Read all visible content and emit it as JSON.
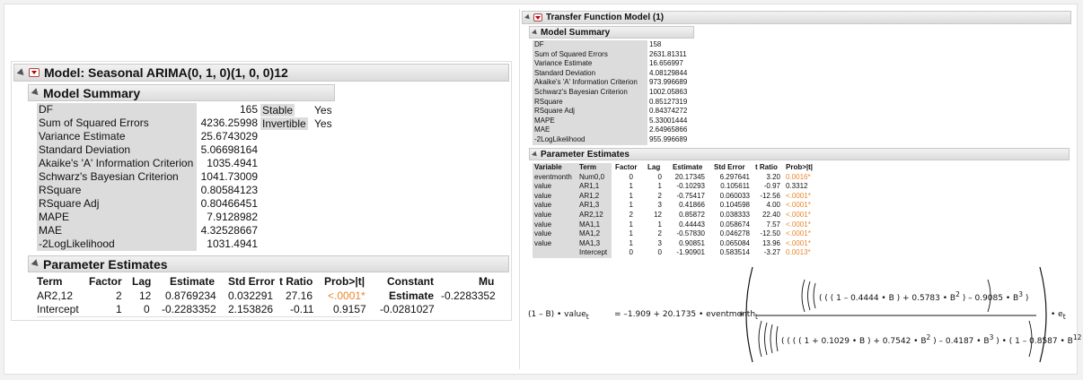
{
  "left": {
    "title": "Model: Seasonal ARIMA(0, 1, 0)(1, 0, 0)12",
    "summary_title": "Model Summary",
    "summary": [
      {
        "label": "DF",
        "value": "165"
      },
      {
        "label": "Sum of Squared Errors",
        "value": "4236.25998"
      },
      {
        "label": "Variance Estimate",
        "value": "25.6743029"
      },
      {
        "label": "Standard Deviation",
        "value": "5.06698164"
      },
      {
        "label": "Akaike's 'A' Information Criterion",
        "value": "1035.4941"
      },
      {
        "label": "Schwarz's Bayesian Criterion",
        "value": "1041.73009"
      },
      {
        "label": "RSquare",
        "value": "0.80584123"
      },
      {
        "label": "RSquare Adj",
        "value": "0.80466451"
      },
      {
        "label": "MAPE",
        "value": "7.9128982"
      },
      {
        "label": "MAE",
        "value": "4.32528667"
      },
      {
        "label": "-2LogLikelihood",
        "value": "1031.4941"
      }
    ],
    "stable_label": "Stable",
    "stable_value": "Yes",
    "invertible_label": "Invertible",
    "invertible_value": "Yes",
    "params_title": "Parameter Estimates",
    "param_headers": [
      "Term",
      "Factor",
      "Lag",
      "Estimate",
      "Std Error",
      "t Ratio",
      "Prob>|t|",
      "Constant",
      "Mu"
    ],
    "param_rows": [
      [
        "AR2,12",
        "2",
        "12",
        "0.8769234",
        "0.032291",
        "27.16",
        "<.0001*"
      ],
      [
        "Intercept",
        "1",
        "0",
        "-0.2283352",
        "2.153826",
        "-0.11",
        "0.9157"
      ]
    ],
    "constant_label": "Estimate",
    "mu_value": "-0.2283352",
    "constant_value": "-0.0281027"
  },
  "right": {
    "title": "Transfer Function Model (1)",
    "summary_title": "Model Summary",
    "summary": [
      {
        "label": "DF",
        "value": "158"
      },
      {
        "label": "Sum of Squared Errors",
        "value": "2631.81311"
      },
      {
        "label": "Variance Estimate",
        "value": "16.656997"
      },
      {
        "label": "Standard Deviation",
        "value": "4.08129844"
      },
      {
        "label": "Akaike's 'A' Information Criterion",
        "value": "973.996689"
      },
      {
        "label": "Schwarz's Bayesian Criterion",
        "value": "1002.05863"
      },
      {
        "label": "RSquare",
        "value": "0.85127319"
      },
      {
        "label": "RSquare Adj",
        "value": "0.84374272"
      },
      {
        "label": "MAPE",
        "value": "5.33001444"
      },
      {
        "label": "MAE",
        "value": "2.64965866"
      },
      {
        "label": "-2LogLikelihood",
        "value": "955.996689"
      }
    ],
    "params_title": "Parameter Estimates",
    "param_headers": [
      "Variable",
      "Term",
      "Factor",
      "Lag",
      "Estimate",
      "Std Error",
      "t Ratio",
      "Prob>|t|"
    ],
    "param_rows": [
      [
        "eventmonth",
        "Num0,0",
        "0",
        "0",
        "20.17345",
        "6.297641",
        "3.20",
        "0.0016*"
      ],
      [
        "value",
        "AR1,1",
        "1",
        "1",
        "-0.10293",
        "0.105611",
        "-0.97",
        "0.3312"
      ],
      [
        "value",
        "AR1,2",
        "1",
        "2",
        "-0.75417",
        "0.060033",
        "-12.56",
        "<.0001*"
      ],
      [
        "value",
        "AR1,3",
        "1",
        "3",
        "0.41866",
        "0.104598",
        "4.00",
        "<.0001*"
      ],
      [
        "value",
        "AR2,12",
        "2",
        "12",
        "0.85872",
        "0.038333",
        "22.40",
        "<.0001*"
      ],
      [
        "value",
        "MA1,1",
        "1",
        "1",
        "0.44443",
        "0.058674",
        "7.57",
        "<.0001*"
      ],
      [
        "value",
        "MA1,2",
        "1",
        "2",
        "-0.57830",
        "0.046278",
        "-12.50",
        "<.0001*"
      ],
      [
        "value",
        "MA1,3",
        "1",
        "3",
        "0.90851",
        "0.065084",
        "13.96",
        "<.0001*"
      ],
      [
        "",
        "Intercept",
        "0",
        "0",
        "-1.90901",
        "0.583514",
        "-3.27",
        "0.0013*"
      ]
    ],
    "significant_color": "#e8872b",
    "formula": {
      "lhs_prefix": "(1 – B) • value",
      "sub_t": "t",
      "rhs_start": "= –1.909 + 20.1735 • eventmonth",
      "plus": "+",
      "numerator": "( ( ( 1 – 0.4444 • B ) + 0.5783 • B",
      "num_tail": ") – 0.9085 • B",
      "denominator": "( ( ( ( 1 + 0.1029 • B ) + 0.7542 • B",
      "den_mid": ") – 0.4187 • B",
      "den_tail": ") • ( 1 – 0.8587 • B",
      "e_term": "• e",
      "exp2": "2",
      "exp3": "3",
      "exp12": "12"
    }
  },
  "icons": [
    "disclosure-triangle-icon",
    "red-triangle-menu-icon"
  ]
}
